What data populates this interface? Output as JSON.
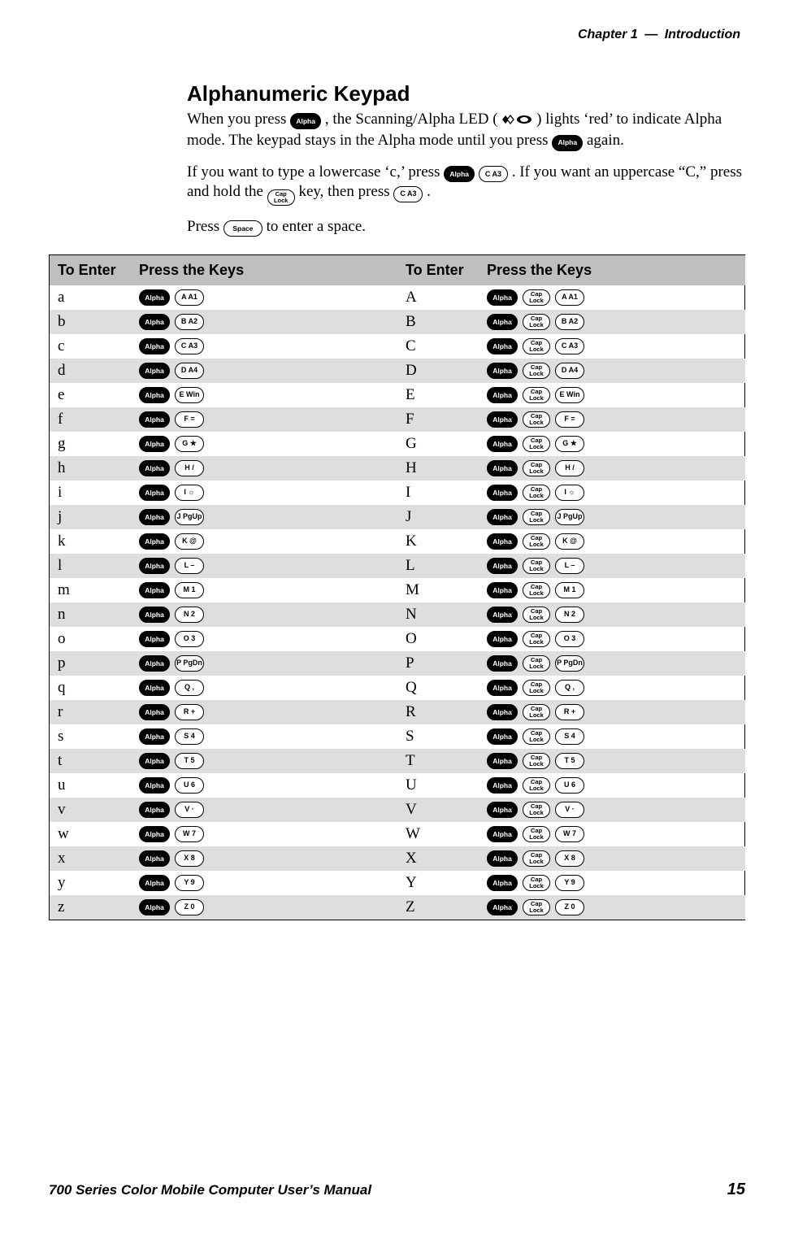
{
  "header": {
    "chapter_label": "Chapter",
    "chapter_num": "1",
    "sep": "—",
    "chapter_title": "Introduction"
  },
  "section_title": "Alphanumeric Keypad",
  "body": {
    "p1_a": "When you press ",
    "p1_b": ", the Scanning/Alpha LED (",
    "p1_c": ") lights ‘red’ to indicate Alpha mode. The keypad stays in the Alpha mode until you press ",
    "p1_d": " again.",
    "p2_a": "If you want to type a lowercase ‘c,’ press ",
    "p2_b": " ",
    "p2_c": ". If you want an uppercase “C,” press and hold the ",
    "p2_d": " key, then press ",
    "p2_e": ".",
    "p3_a": "Press ",
    "p3_b": " to enter a space."
  },
  "keys_label": {
    "alpha": "Alpha",
    "cap": "Cap Lock",
    "space": "Space"
  },
  "table": {
    "headers": [
      "To Enter",
      "Press the Keys",
      "To Enter",
      "Press the Keys"
    ],
    "rows": [
      {
        "lc": "a",
        "up": "A",
        "key": "A A1"
      },
      {
        "lc": "b",
        "up": "B",
        "key": "B A2"
      },
      {
        "lc": "c",
        "up": "C",
        "key": "C A3"
      },
      {
        "lc": "d",
        "up": "D",
        "key": "D A4"
      },
      {
        "lc": "e",
        "up": "E",
        "key": "E Win"
      },
      {
        "lc": "f",
        "up": "F",
        "key": "F ="
      },
      {
        "lc": "g",
        "up": "G",
        "key": "G ★"
      },
      {
        "lc": "h",
        "up": "H",
        "key": "H /"
      },
      {
        "lc": "i",
        "up": "I",
        "key": "I ☼"
      },
      {
        "lc": "j",
        "up": "J",
        "key": "J PgUp"
      },
      {
        "lc": "k",
        "up": "K",
        "key": "K @"
      },
      {
        "lc": "l",
        "up": "L",
        "key": "L –"
      },
      {
        "lc": "m",
        "up": "M",
        "key": "M 1"
      },
      {
        "lc": "n",
        "up": "N",
        "key": "N 2"
      },
      {
        "lc": "o",
        "up": "O",
        "key": "O 3"
      },
      {
        "lc": "p",
        "up": "P",
        "key": "P PgDn"
      },
      {
        "lc": "q",
        "up": "Q",
        "key": "Q ,"
      },
      {
        "lc": "r",
        "up": "R",
        "key": "R +"
      },
      {
        "lc": "s",
        "up": "S",
        "key": "S 4"
      },
      {
        "lc": "t",
        "up": "T",
        "key": "T 5"
      },
      {
        "lc": "u",
        "up": "U",
        "key": "U 6"
      },
      {
        "lc": "v",
        "up": "V",
        "key": "V ·"
      },
      {
        "lc": "w",
        "up": "W",
        "key": "W 7"
      },
      {
        "lc": "x",
        "up": "X",
        "key": "X 8"
      },
      {
        "lc": "y",
        "up": "Y",
        "key": "Y 9"
      },
      {
        "lc": "z",
        "up": "Z",
        "key": "Z 0"
      }
    ]
  },
  "footer": {
    "title": "700 Series Color Mobile Computer User’s Manual",
    "page": "15"
  }
}
